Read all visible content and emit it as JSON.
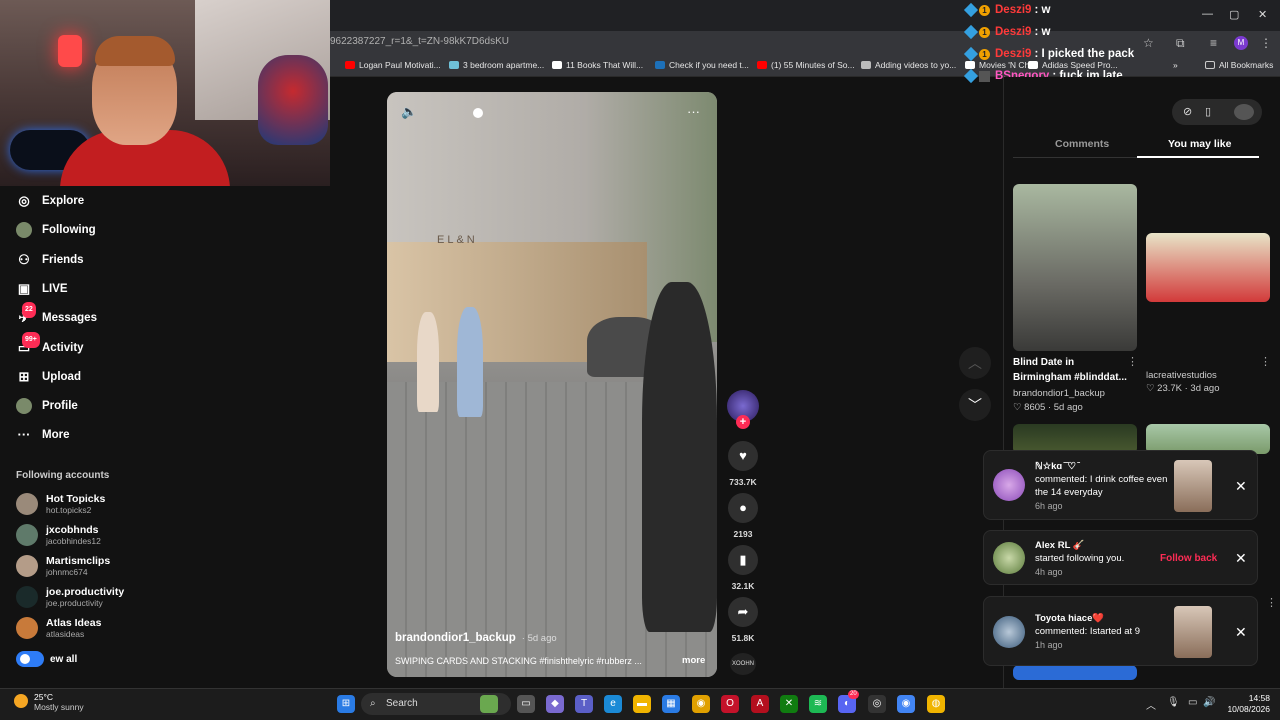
{
  "browser": {
    "url": "9622387227_r=1&_t=ZN-98kK7D6dsKU",
    "profile_initial": "M",
    "bookmarks": [
      {
        "label": "Logan Paul Motivati...",
        "color": "#ff0000"
      },
      {
        "label": "3 bedroom apartme...",
        "color": "#6fc1d8"
      },
      {
        "label": "11 Books That Will...",
        "color": "#ffffff"
      },
      {
        "label": "Check if you need t...",
        "color": "#1d70b8"
      },
      {
        "label": "(1) 55 Minutes of So...",
        "color": "#ff0000"
      },
      {
        "label": "Adding videos to yo...",
        "color": "#bbbbbb"
      },
      {
        "label": "Movies 'N Chill",
        "color": "#ffffff"
      },
      {
        "label": "Adidas Speed Pro...",
        "color": "#ffffff"
      }
    ],
    "all_bookmarks": "All Bookmarks"
  },
  "chat": [
    {
      "name": "Deszi9",
      "msg": " : w"
    },
    {
      "name": "Deszi9",
      "msg": " : w"
    },
    {
      "name": "Deszi9",
      "msg": " : I picked the pack"
    },
    {
      "name": "BSnegory",
      "msg": " : fuck im late"
    }
  ],
  "sidebar": {
    "nav": [
      {
        "label": "Explore",
        "icon": "compass-icon",
        "glyph": "◎"
      },
      {
        "label": "Following",
        "icon": "following-avatar-icon",
        "glyph": "●"
      },
      {
        "label": "Friends",
        "icon": "friends-icon",
        "glyph": "⚇"
      },
      {
        "label": "LIVE",
        "icon": "live-icon",
        "glyph": "▣"
      },
      {
        "label": "Messages",
        "icon": "messages-icon",
        "glyph": "✈",
        "badge": "22"
      },
      {
        "label": "Activity",
        "icon": "activity-icon",
        "glyph": "▭",
        "badge": "99+"
      },
      {
        "label": "Upload",
        "icon": "upload-icon",
        "glyph": "⊞"
      },
      {
        "label": "Profile",
        "icon": "profile-avatar-icon",
        "glyph": "●"
      },
      {
        "label": "More",
        "icon": "more-icon",
        "glyph": "···"
      }
    ],
    "following_header": "Following accounts",
    "accounts": [
      {
        "name": "Hot Topicks",
        "handle": "hot.topicks2",
        "color": "#9a8a7a"
      },
      {
        "name": "jxcobhnds",
        "handle": "jacobhindes12",
        "color": "#5f7a6a"
      },
      {
        "name": "Martismclips",
        "handle": "johnmc674",
        "color": "#b49c88"
      },
      {
        "name": "joe.productivity",
        "handle": "joe.productivity",
        "color": "#1a2a2a"
      },
      {
        "name": "Atlas Ideas",
        "handle": "atlasideas",
        "color": "#c87a3a"
      }
    ],
    "view_all": "ew all"
  },
  "video": {
    "username": "brandondior1_backup",
    "age": "· 5d ago",
    "caption": "SWIPING CARDS AND STACKING #finishthelyric #rubberz ...",
    "more": "more",
    "shop_sign": "EL&N",
    "likes": "733.7K",
    "comments": "2193",
    "saves": "32.1K",
    "shares": "51.8K",
    "music_label": "XOOHN"
  },
  "right_panel": {
    "tab_comments": "Comments",
    "tab_you_may_like": "You may like",
    "cards": [
      {
        "title": "Blind Date in Birmingham #blinddat...",
        "user": "brandondior1_backup",
        "meta": "♡ 8605 · 5d ago"
      },
      {
        "title": "",
        "user": "lacreativestudios",
        "meta": "♡ 23.7K · 3d ago"
      }
    ]
  },
  "notifications": [
    {
      "name": "ℕ☆kɑ ̄ ̄♡ ̄",
      "text": "commented: I drink coffee even the 14 everyday",
      "time": "6h ago"
    },
    {
      "name": "Alex RL 🎸",
      "text": "started following you.",
      "time": "4h ago",
      "action": "Follow back"
    },
    {
      "name": "Toyota hiace❤️",
      "text": "commented: Istarted at 9",
      "time": "1h ago"
    }
  ],
  "taskbar": {
    "temp": "25°C",
    "weather": "Mostly sunny",
    "search": "Search",
    "time": "14:58",
    "date": "10/08/2026",
    "discord_badge": "20"
  }
}
